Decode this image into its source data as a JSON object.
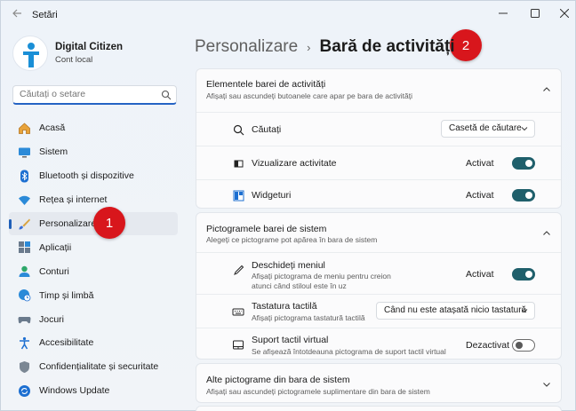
{
  "window": {
    "title": "Setări"
  },
  "profile": {
    "name": "Digital Citizen",
    "account_type": "Cont local"
  },
  "search": {
    "placeholder": "Căutați o setare"
  },
  "sidebar": {
    "items": [
      {
        "label": "Acasă",
        "icon": "home-icon"
      },
      {
        "label": "Sistem",
        "icon": "system-icon"
      },
      {
        "label": "Bluetooth și dispozitive",
        "icon": "bluetooth-icon"
      },
      {
        "label": "Rețea și internet",
        "icon": "wifi-icon"
      },
      {
        "label": "Personalizare",
        "icon": "brush-icon",
        "active": true
      },
      {
        "label": "Aplicații",
        "icon": "apps-icon"
      },
      {
        "label": "Conturi",
        "icon": "account-icon"
      },
      {
        "label": "Timp și limbă",
        "icon": "globe-clock-icon"
      },
      {
        "label": "Jocuri",
        "icon": "gamepad-icon"
      },
      {
        "label": "Accesibilitate",
        "icon": "accessibility-icon"
      },
      {
        "label": "Confidențialitate și securitate",
        "icon": "shield-icon"
      },
      {
        "label": "Windows Update",
        "icon": "update-icon"
      }
    ]
  },
  "badges": {
    "one": "1",
    "two": "2"
  },
  "breadcrumb": {
    "parent": "Personalizare",
    "separator": "›",
    "current": "Bară de activități"
  },
  "taskbar_items": {
    "title": "Elementele barei de activități",
    "subtitle": "Afișați sau ascundeți butoanele care apar pe bara de activități",
    "rows": [
      {
        "label": "Căutați",
        "control": "dropdown",
        "value": "Casetă de căutare",
        "icon": "search-icon"
      },
      {
        "label": "Vizualizare activitate",
        "control": "toggle",
        "status": "Activat",
        "on": true,
        "icon": "task-view-icon"
      },
      {
        "label": "Widgeturi",
        "control": "toggle",
        "status": "Activat",
        "on": true,
        "icon": "widgets-icon"
      }
    ]
  },
  "system_tray": {
    "title": "Pictogramele barei de sistem",
    "subtitle": "Alegeți ce pictograme pot apărea în bara de sistem",
    "rows": [
      {
        "label": "Deschideți meniul",
        "desc": "Afișați pictograma de meniu pentru creion atunci când stiloul este în uz",
        "control": "toggle",
        "status": "Activat",
        "on": true,
        "icon": "pen-icon"
      },
      {
        "label": "Tastatura tactilă",
        "desc": "Afișați pictograma tastatură tactilă",
        "control": "dropdown",
        "value": "Când nu este atașată nicio tastatură",
        "icon": "keyboard-icon"
      },
      {
        "label": "Suport tactil virtual",
        "desc": "Se afișează întotdeauna pictograma de suport tactil virtual",
        "control": "toggle",
        "status": "Dezactivat",
        "on": false,
        "icon": "touchpad-icon"
      }
    ]
  },
  "other_tray": {
    "title": "Alte pictograme din bara de sistem",
    "subtitle": "Afișați sau ascundeți pictogramele suplimentare din bara de sistem"
  },
  "colors": {
    "accent": "#1f5f6b",
    "badge": "#d8161c",
    "nav_indicator": "#1f5fb8"
  }
}
